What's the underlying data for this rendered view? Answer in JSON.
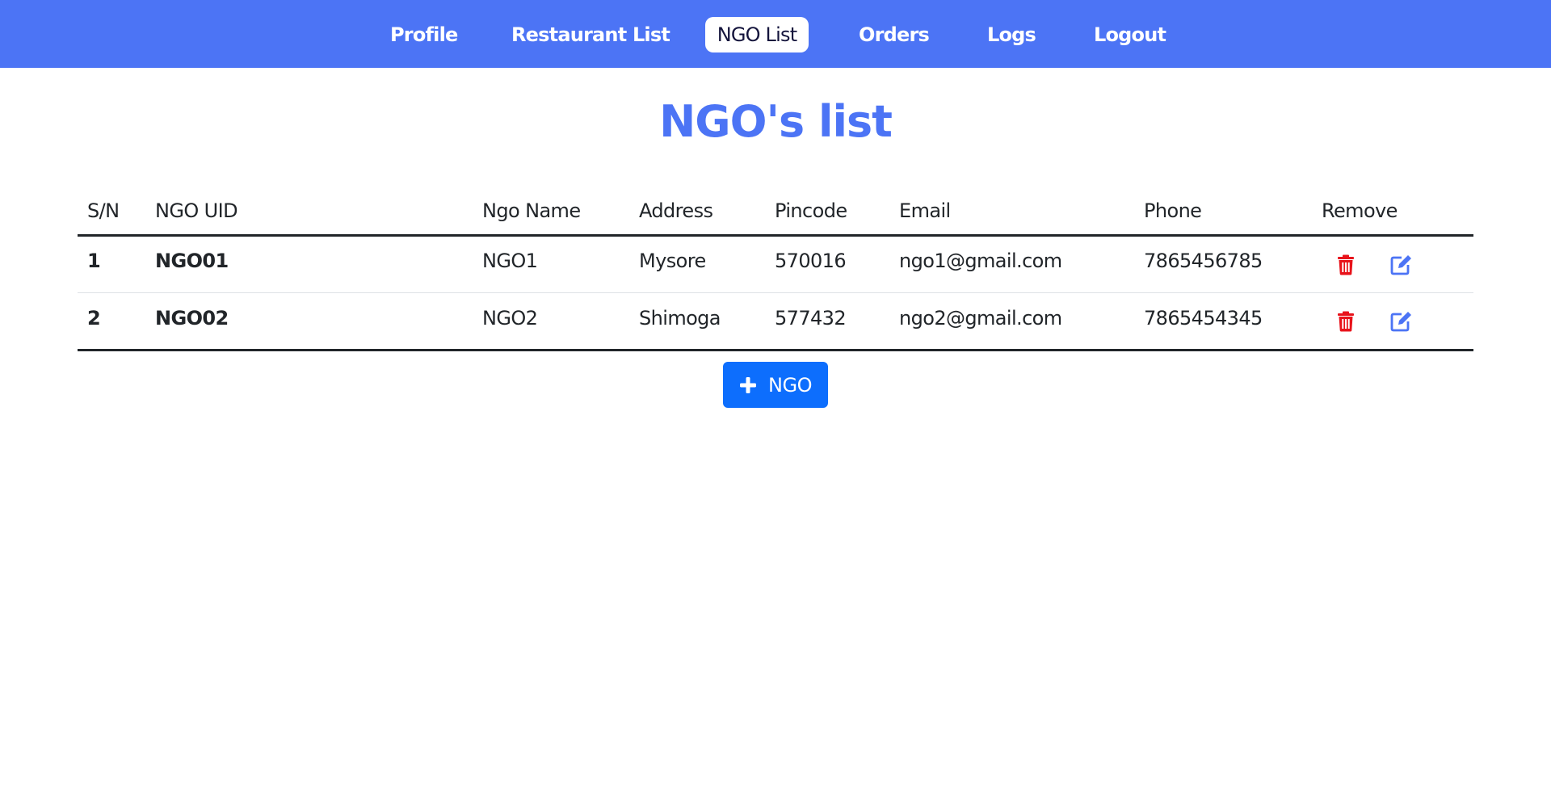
{
  "nav": {
    "items": [
      {
        "label": "Profile",
        "active": false
      },
      {
        "label": "Restaurant List",
        "active": false
      },
      {
        "label": "NGO List",
        "active": true
      },
      {
        "label": "Orders",
        "active": false
      },
      {
        "label": "Logs",
        "active": false
      },
      {
        "label": "Logout",
        "active": false
      }
    ]
  },
  "page": {
    "title": "NGO's list"
  },
  "table": {
    "headers": [
      "S/N",
      "NGO UID",
      "Ngo Name",
      "Address",
      "Pincode",
      "Email",
      "Phone",
      "Remove"
    ],
    "rows": [
      {
        "sn": "1",
        "uid": "NGO01",
        "name": "NGO1",
        "address": "Mysore",
        "pincode": "570016",
        "email": "ngo1@gmail.com",
        "phone": "7865456785"
      },
      {
        "sn": "2",
        "uid": "NGO02",
        "name": "NGO2",
        "address": "Shimoga",
        "pincode": "577432",
        "email": "ngo2@gmail.com",
        "phone": "7865454345"
      }
    ],
    "actions": {
      "delete_icon": "trash-icon",
      "edit_icon": "edit-icon"
    }
  },
  "add_button": {
    "label": "NGO",
    "icon": "plus-icon"
  },
  "colors": {
    "nav_bg": "#4c74f5",
    "title": "#4c74f5",
    "delete": "#e8131b",
    "edit": "#4c74f5",
    "primary_button": "#0d6efd"
  }
}
